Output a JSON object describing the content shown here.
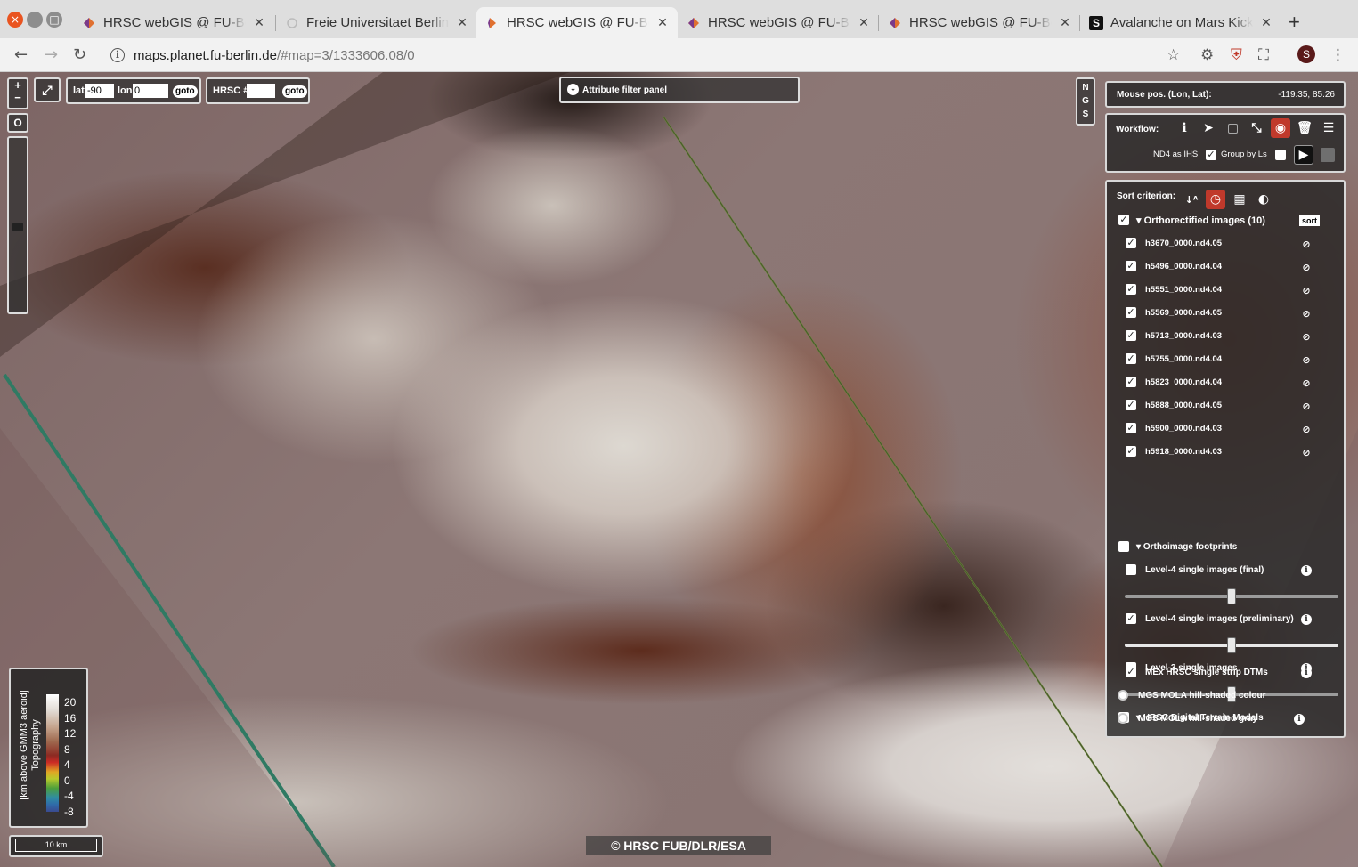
{
  "browser": {
    "tabs": [
      {
        "title": "HRSC webGIS @ FU-Berlin",
        "favicon": "hrsc-favicon",
        "active": false
      },
      {
        "title": "Freie Universitaet Berlin",
        "favicon": "loading-favicon",
        "active": false
      },
      {
        "title": "HRSC webGIS @ FU-Berlin",
        "favicon": "hrsc-favicon",
        "active": true
      },
      {
        "title": "HRSC webGIS @ FU-Berlin",
        "favicon": "hrsc-favicon",
        "active": false
      },
      {
        "title": "HRSC webGIS @ FU-Berlin",
        "favicon": "hrsc-favicon",
        "active": false
      },
      {
        "title": "Avalanche on Mars Kick",
        "favicon": "S",
        "active": false
      }
    ],
    "url_host": "maps.planet.fu-berlin.de",
    "url_path": "/#map=3/1333606.08/0",
    "profile_initial": "S"
  },
  "map_controls": {
    "zoom_in": "+",
    "zoom_out": "−",
    "reset": "O",
    "fullscreen": "⤢",
    "lat_label": "lat",
    "lat_value": "-90",
    "lon_label": "lon",
    "lon_value": "0",
    "goto_label": "goto",
    "hrsc_label": "HRSC #",
    "hrsc_value": "",
    "attribute_filter": "Attribute filter panel",
    "ngs": [
      "N",
      "G",
      "S"
    ]
  },
  "mouse_pos": {
    "label": "Mouse pos. (Lon, Lat):",
    "value": "-119.35, 85.26"
  },
  "workflow": {
    "label": "Workflow:",
    "nd4_label": "ND4 as IHS",
    "nd4_checked": true,
    "group_label": "Group by Ls",
    "group_checked": false
  },
  "layers": {
    "sort_label": "Sort criterion:",
    "sort_button": "sort",
    "ortho_title": "Orthorectified images (10)",
    "ortho_items": [
      "h3670_0000.nd4.05",
      "h5496_0000.nd4.04",
      "h5551_0000.nd4.04",
      "h5569_0000.nd4.05",
      "h5713_0000.nd4.03",
      "h5755_0000.nd4.04",
      "h5823_0000.nd4.04",
      "h5888_0000.nd4.05",
      "h5900_0000.nd4.03",
      "h5918_0000.nd4.03"
    ],
    "footprints_title": "Orthoimage footprints",
    "level4_final": "Level-4 single images (final)",
    "level4_prelim": "Level-4 single images (preliminary)",
    "level3": "Level-3 single images",
    "dtm_title": "HRSC Digital Terrain Models",
    "dtm_item": "MEx HRSC single strip DTMs",
    "mola_colour": "MGS MOLA hill-shaded colour",
    "mola_gray": "MGS MOLA hill-shaded gray"
  },
  "legend": {
    "title_line1": "Topography",
    "title_line2": "[km above GMM3 aeroid]",
    "ticks": [
      "20",
      "16",
      "12",
      "8",
      "4",
      "0",
      "-4",
      "-8"
    ]
  },
  "scalebar": "10 km",
  "copyright": "© HRSC FUB/DLR/ESA"
}
